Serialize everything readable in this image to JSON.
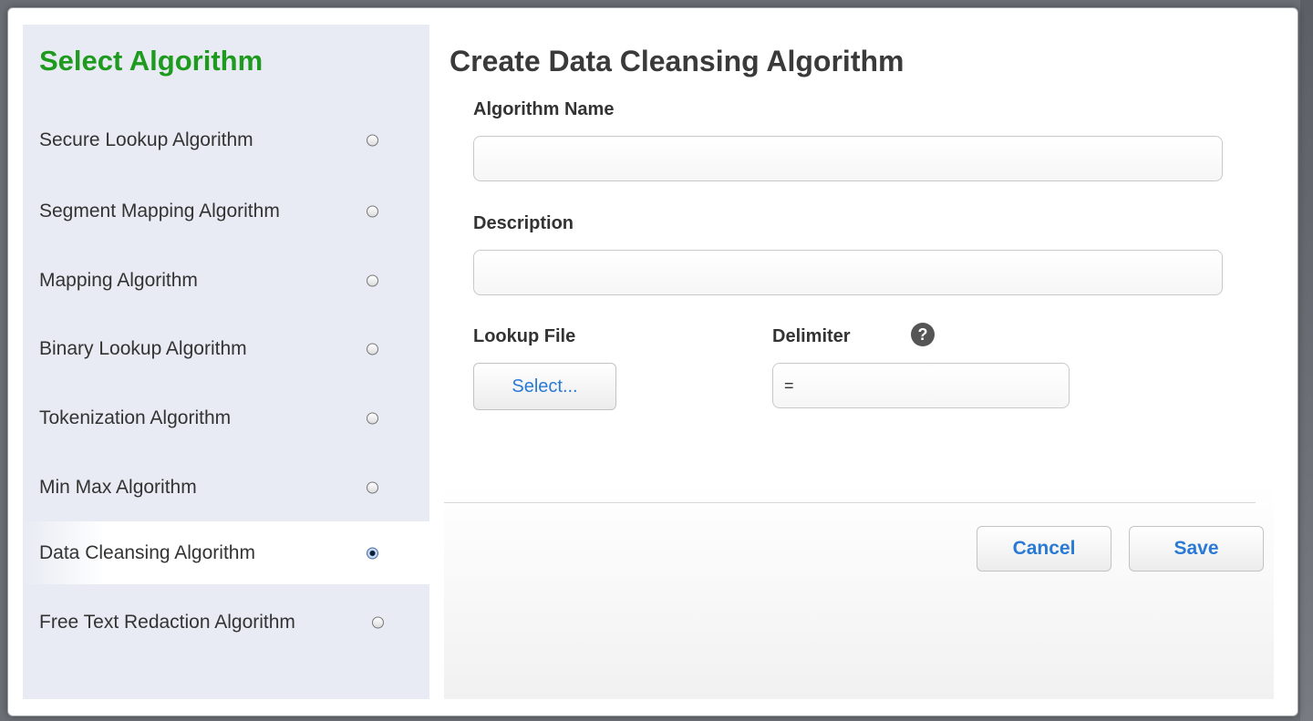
{
  "sidebar": {
    "title": "Select Algorithm",
    "items": [
      {
        "label": "Secure Lookup Algorithm",
        "selected": false
      },
      {
        "label": "Segment Mapping Algorithm",
        "selected": false
      },
      {
        "label": "Mapping Algorithm",
        "selected": false
      },
      {
        "label": "Binary Lookup Algorithm",
        "selected": false
      },
      {
        "label": "Tokenization Algorithm",
        "selected": false
      },
      {
        "label": "Min Max Algorithm",
        "selected": false
      },
      {
        "label": "Data Cleansing Algorithm",
        "selected": true
      },
      {
        "label": "Free Text Redaction Algorithm",
        "selected": false
      }
    ]
  },
  "form": {
    "title": "Create Data Cleansing Algorithm",
    "algorithm_name_label": "Algorithm Name",
    "algorithm_name_value": "",
    "description_label": "Description",
    "description_value": "",
    "lookup_file_label": "Lookup File",
    "select_button_label": "Select...",
    "delimiter_label": "Delimiter",
    "delimiter_value": "=",
    "help_icon": "question-circle-icon",
    "help_glyph": "?"
  },
  "footer": {
    "cancel_label": "Cancel",
    "save_label": "Save"
  },
  "colors": {
    "sidebar_title": "#1e9a1e",
    "sidebar_bg": "#e8ebf3",
    "button_text": "#2a7ad5"
  }
}
